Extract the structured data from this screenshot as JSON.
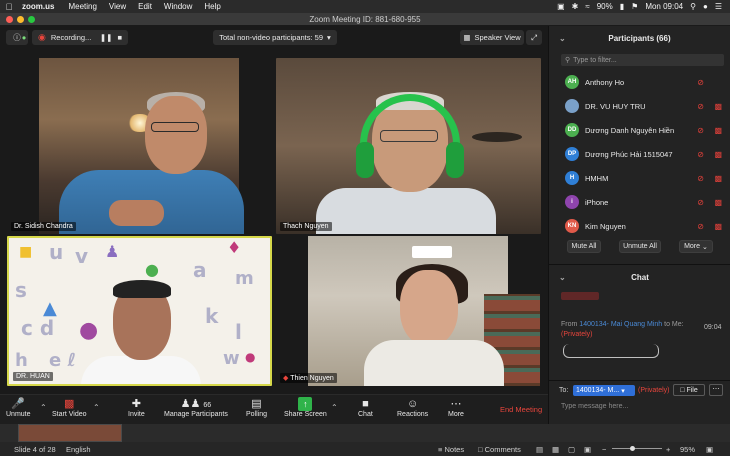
{
  "menubar": {
    "app": "zoom.us",
    "items": [
      "Meeting",
      "View",
      "Edit",
      "Window",
      "Help"
    ],
    "battery": "90%",
    "clock": "Mon 09:04"
  },
  "window": {
    "title": "Zoom Meeting ID: 881-680-955"
  },
  "video_top": {
    "recording_label": "Recording...",
    "non_video_label": "Total non-video participants: 59",
    "speaker_view_label": "Speaker View"
  },
  "tiles": [
    {
      "name": "Dr. Sidish Chandra"
    },
    {
      "name": "Thach Nguyen"
    },
    {
      "name": "DR. HUAN"
    },
    {
      "name": "Thien Nguyen"
    }
  ],
  "toolbar": {
    "unmute": "Unmute",
    "start_video": "Start Video",
    "invite": "Invite",
    "manage_participants": "Manage Participants",
    "participants_count": "66",
    "polling": "Polling",
    "share_screen": "Share Screen",
    "chat": "Chat",
    "reactions": "Reactions",
    "more": "More",
    "end_meeting": "End Meeting"
  },
  "participants_panel": {
    "title": "Participants (66)",
    "filter_placeholder": "Type to filter...",
    "participants": [
      {
        "initials": "AH",
        "name": "Anthony Ho",
        "color": "#4caf50"
      },
      {
        "initials": "",
        "name": "DR. VU HUY TRU",
        "color": "#7aa0c8"
      },
      {
        "initials": "DD",
        "name": "Dương Danh Nguyên Hiền",
        "color": "#4caf50"
      },
      {
        "initials": "DP",
        "name": "Dương Phúc Hải 1515047",
        "color": "#2f7fd6"
      },
      {
        "initials": "H",
        "name": "HMHM",
        "color": "#2f7fd6"
      },
      {
        "initials": "i",
        "name": "iPhone",
        "color": "#8e44ad"
      },
      {
        "initials": "KN",
        "name": "Kim Nguyen",
        "color": "#e05a4a"
      }
    ],
    "mute_all": "Mute All",
    "unmute_all": "Unmute All",
    "more": "More"
  },
  "chat_panel": {
    "title": "Chat",
    "message_from_prefix": "From",
    "message_sender": "1400134- Mai Quang Minh",
    "message_to": "to Me:",
    "message_privately": "(Privately)",
    "message_time": "09:04",
    "to_label": "To:",
    "to_value": "1400134- M...",
    "to_privately": "(Privately)",
    "file_button": "File",
    "input_placeholder": "Type message here..."
  },
  "statusbar": {
    "slide": "Slide 4 of 28",
    "language": "English",
    "notes": "Notes",
    "comments": "Comments",
    "zoom": "95%"
  },
  "colors": {
    "end_meeting": "#e8453c",
    "highlight_border": "#d6d84a",
    "headset": "#27c24c"
  }
}
